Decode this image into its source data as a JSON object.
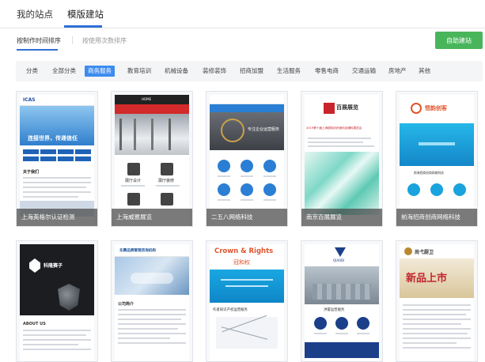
{
  "top_tabs": [
    "我的站点",
    "模版建站"
  ],
  "sort": {
    "by_time": "按制作时间排序",
    "by_usage": "按使用次数排序"
  },
  "build_button": "自助建站",
  "categories": [
    {
      "label": "分类",
      "active": false
    },
    {
      "label": "全部分类",
      "active": false
    },
    {
      "label": "商务服务",
      "active": true
    },
    {
      "label": "教育培训",
      "active": false
    },
    {
      "label": "机械设备",
      "active": false
    },
    {
      "label": "装修装饰",
      "active": false
    },
    {
      "label": "招商加盟",
      "active": false
    },
    {
      "label": "生活服务",
      "active": false
    },
    {
      "label": "零售电商",
      "active": false
    },
    {
      "label": "交通运输",
      "active": false
    },
    {
      "label": "房地产",
      "active": false
    },
    {
      "label": "其他",
      "active": false
    }
  ],
  "templates": [
    {
      "caption": "上海英格尔认证检测",
      "thumb": {
        "brand": "ICAS",
        "headline": "连接世界，传递信任",
        "section": "关于我们"
      }
    },
    {
      "caption": "上海威雅展览",
      "thumb": {
        "nav": "HOME",
        "item1": "展厅设计",
        "item2": "展厅装修"
      }
    },
    {
      "caption": "二五八网络科技",
      "thumb": {
        "slogan": "专注企业运营服务"
      }
    },
    {
      "caption": "南京百展展览",
      "thumb": {
        "logo": "百展展览",
        "text": "2019第十届上海国际纺织面料及辅料展览会"
      }
    },
    {
      "caption": "前海招商创商网络科技",
      "thumb": {
        "logo": "悟韵创客",
        "text": "前海招商创商网络科技"
      }
    },
    {
      "caption": "",
      "thumb": {
        "logo": "科隆赛子",
        "section": "ABOUT US"
      }
    },
    {
      "caption": "",
      "thumb": {
        "logo": "东赛品牌管理咨询机构",
        "section": "公司简介"
      }
    },
    {
      "caption": "",
      "thumb": {
        "title1": "Crown & Rights",
        "title2": "冠和权",
        "section": "作者知识产权运营服务"
      }
    },
    {
      "caption": "",
      "thumb": {
        "logo": "QIAOBI",
        "text": "洪雷运营服务"
      }
    },
    {
      "caption": "",
      "thumb": {
        "logo": "尚弋厨卫",
        "headline": "新品上市"
      }
    }
  ],
  "colors": {
    "accent": "#2f6fd6",
    "active_cat": "#3c8cf0",
    "build": "#49b55b"
  }
}
